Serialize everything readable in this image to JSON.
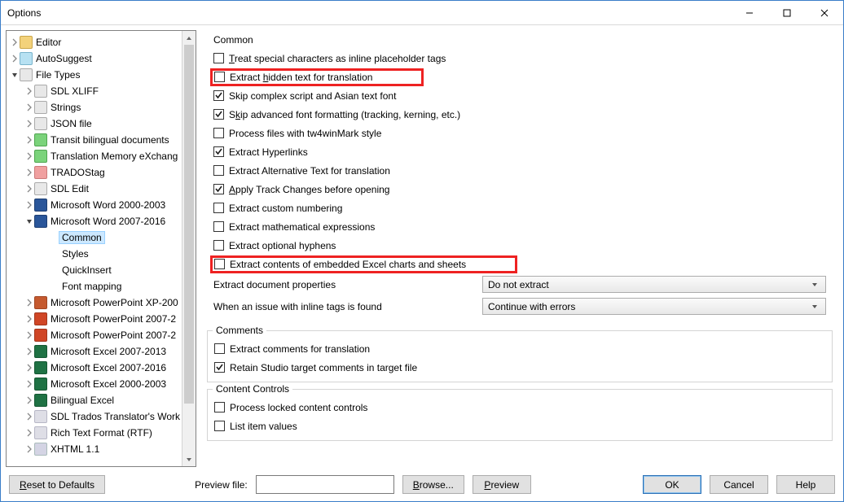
{
  "window": {
    "title": "Options"
  },
  "tree": {
    "items": [
      {
        "depth": 0,
        "tw": "r",
        "icon": "pen",
        "label": "Editor"
      },
      {
        "depth": 0,
        "tw": "r",
        "icon": "ab",
        "label": "AutoSuggest"
      },
      {
        "depth": 0,
        "tw": "d",
        "icon": "doc",
        "label": "File Types"
      },
      {
        "depth": 1,
        "tw": "r",
        "icon": "doc",
        "label": "SDL XLIFF"
      },
      {
        "depth": 1,
        "tw": "r",
        "icon": "doc",
        "label": "Strings"
      },
      {
        "depth": 1,
        "tw": "r",
        "icon": "doc",
        "label": "JSON file"
      },
      {
        "depth": 1,
        "tw": "r",
        "icon": "db",
        "label": "Transit bilingual documents"
      },
      {
        "depth": 1,
        "tw": "r",
        "icon": "db",
        "label": "Translation Memory eXchang"
      },
      {
        "depth": 1,
        "tw": "r",
        "icon": "tag",
        "label": "TRADOStag"
      },
      {
        "depth": 1,
        "tw": "r",
        "icon": "doc",
        "label": "SDL Edit"
      },
      {
        "depth": 1,
        "tw": "r",
        "icon": "word",
        "label": "Microsoft Word 2000-2003"
      },
      {
        "depth": 1,
        "tw": "d",
        "icon": "word",
        "label": "Microsoft Word 2007-2016"
      },
      {
        "depth": 2,
        "tw": "",
        "icon": "",
        "label": "Common",
        "selected": true
      },
      {
        "depth": 2,
        "tw": "",
        "icon": "",
        "label": "Styles"
      },
      {
        "depth": 2,
        "tw": "",
        "icon": "",
        "label": "QuickInsert"
      },
      {
        "depth": 2,
        "tw": "",
        "icon": "",
        "label": "Font mapping"
      },
      {
        "depth": 1,
        "tw": "r",
        "icon": "wordr",
        "label": "Microsoft PowerPoint XP-200"
      },
      {
        "depth": 1,
        "tw": "r",
        "icon": "ppt",
        "label": "Microsoft PowerPoint 2007-2"
      },
      {
        "depth": 1,
        "tw": "r",
        "icon": "ppt",
        "label": "Microsoft PowerPoint 2007-2"
      },
      {
        "depth": 1,
        "tw": "r",
        "icon": "excel",
        "label": "Microsoft Excel 2007-2013"
      },
      {
        "depth": 1,
        "tw": "r",
        "icon": "excel",
        "label": "Microsoft Excel 2007-2016"
      },
      {
        "depth": 1,
        "tw": "r",
        "icon": "excel",
        "label": "Microsoft Excel 2000-2003"
      },
      {
        "depth": 1,
        "tw": "r",
        "icon": "excel",
        "label": "Bilingual Excel"
      },
      {
        "depth": 1,
        "tw": "r",
        "icon": "rtf",
        "label": "SDL Trados Translator's Work"
      },
      {
        "depth": 1,
        "tw": "r",
        "icon": "rtf",
        "label": "Rich Text Format (RTF)"
      },
      {
        "depth": 1,
        "tw": "r",
        "icon": "xhtml",
        "label": "XHTML 1.1"
      }
    ]
  },
  "common": {
    "title": "Common",
    "checks": [
      {
        "label": "Treat special characters as inline placeholder tags",
        "checked": false,
        "und": "T",
        "hl": false
      },
      {
        "label": "Extract hidden text for translation",
        "checked": false,
        "und": "h",
        "hl": true
      },
      {
        "label": "Skip complex script and Asian text font",
        "checked": true,
        "und": "",
        "hl": false
      },
      {
        "label": "Skip advanced font formatting (tracking, kerning, etc.)",
        "checked": true,
        "und": "k",
        "hl": false
      },
      {
        "label": "Process files with tw4winMark style",
        "checked": false,
        "und": "",
        "hl": false
      },
      {
        "label": "Extract Hyperlinks",
        "checked": true,
        "und": "",
        "hl": false
      },
      {
        "label": "Extract Alternative Text for translation",
        "checked": false,
        "und": "",
        "hl": false
      },
      {
        "label": "Apply Track Changes before opening",
        "checked": true,
        "und": "A",
        "hl": false
      },
      {
        "label": "Extract custom numbering",
        "checked": false,
        "und": "",
        "hl": false
      },
      {
        "label": "Extract mathematical expressions",
        "checked": false,
        "und": "",
        "hl": false
      },
      {
        "label": "Extract optional hyphens",
        "checked": false,
        "und": "",
        "hl": false
      },
      {
        "label": "Extract contents of embedded Excel charts and sheets",
        "checked": false,
        "und": "",
        "hl": true
      }
    ],
    "extract_doc_props_label": "Extract document properties",
    "extract_doc_props_value": "Do not extract",
    "inline_tags_label": "When an issue with inline tags is found",
    "inline_tags_value": "Continue with errors"
  },
  "comments": {
    "title": "Comments",
    "checks": [
      {
        "label": "Extract comments for translation",
        "checked": false
      },
      {
        "label": "Retain Studio target comments in target file",
        "checked": true
      }
    ]
  },
  "content_controls": {
    "title": "Content Controls",
    "checks": [
      {
        "label": "Process locked content controls",
        "checked": false
      },
      {
        "label": "List item values",
        "checked": false
      }
    ]
  },
  "footer": {
    "reset": "Reset to Defaults",
    "preview_label": "Preview file:",
    "browse": "Browse...",
    "preview": "Preview",
    "ok": "OK",
    "cancel": "Cancel",
    "help": "Help"
  }
}
